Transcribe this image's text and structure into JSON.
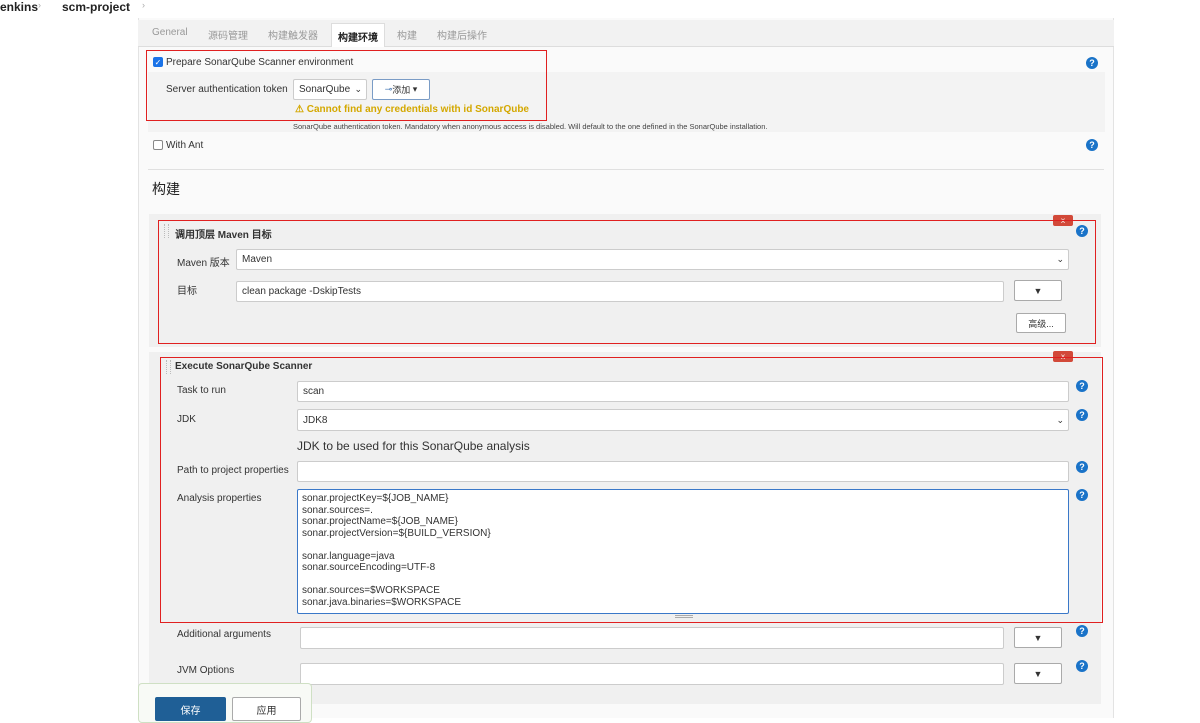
{
  "breadcrumb": {
    "items": [
      "enkins",
      "scm-project"
    ]
  },
  "tabs": [
    "General",
    "源码管理",
    "构建触发器",
    "构建环境",
    "构建",
    "构建后操作"
  ],
  "build_env": {
    "sonar_checkbox_label": "Prepare SonarQube Scanner environment",
    "sonar_checked": true,
    "server_token_label": "Server authentication token",
    "server_token_value": "SonarQube",
    "add_button": "添加",
    "warning": "Cannot find any credentials with id SonarQube",
    "help_text": "SonarQube authentication token. Mandatory when anonymous access is disabled. Will default to the one defined in the SonarQube installation.",
    "ant_label": "With Ant",
    "ant_checked": false
  },
  "build": {
    "heading": "构建",
    "maven": {
      "title": "调用顶层 Maven 目标",
      "version_label": "Maven 版本",
      "version_value": "Maven",
      "goals_label": "目标",
      "goals_value": "clean package -DskipTests",
      "advanced_button": "高级..."
    },
    "sonar": {
      "title": "Execute SonarQube Scanner",
      "task_label": "Task to run",
      "task_value": "scan",
      "jdk_label": "JDK",
      "jdk_value": "JDK8",
      "jdk_help": "JDK to be used for this SonarQube analysis",
      "path_label": "Path to project properties",
      "path_value": "",
      "analysis_label": "Analysis properties",
      "analysis_value": "sonar.projectKey=${JOB_NAME}\nsonar.sources=.\nsonar.projectName=${JOB_NAME}\nsonar.projectVersion=${BUILD_VERSION}\n\nsonar.language=java\nsonar.sourceEncoding=UTF-8\n\nsonar.sources=$WORKSPACE\nsonar.java.binaries=$WORKSPACE",
      "additional_label": "Additional arguments",
      "additional_value": "",
      "jvm_label": "JVM Options",
      "jvm_value": ""
    }
  },
  "footer": {
    "save": "保存",
    "apply": "应用"
  },
  "colors": {
    "primary": "#1f5f96",
    "warning": "#d4a800",
    "help": "#1a73c8",
    "delete": "#d24939"
  }
}
